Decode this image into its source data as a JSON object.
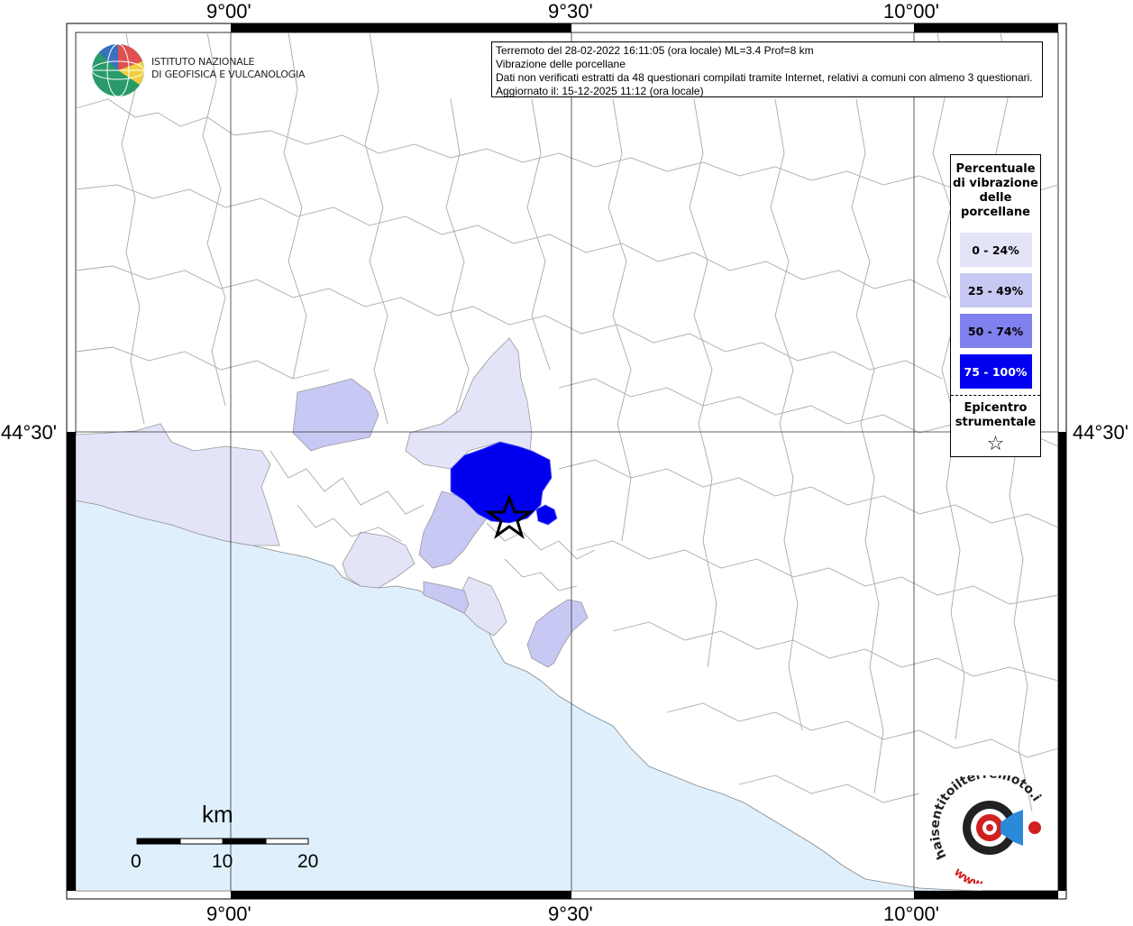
{
  "coords": {
    "top_labels": [
      "9°00'",
      "9°30'",
      "10°00'"
    ],
    "bottom_labels": [
      "9°00'",
      "9°30'",
      "10°00'"
    ],
    "left_label": "44°30'",
    "right_label": "44°30'"
  },
  "title_box": {
    "line1": "Terremoto del 28-02-2022 16:11:05 (ora locale) ML=3.4 Prof=8 km",
    "line2": "Vibrazione delle porcellane",
    "line3": "Dati non verificati estratti da 48 questionari compilati tramite Internet, relativi a comuni con almeno 3 questionari.",
    "line4": "Aggiornato il: 15-12-2025 11:12 (ora locale)"
  },
  "ingv": {
    "line1": "ISTITUTO NAZIONALE",
    "line2": "DI GEOFISICA E VULCANOLOGIA"
  },
  "legend": {
    "title_lines": [
      "Percentuale",
      "di vibrazione",
      "delle",
      "porcellane"
    ],
    "items": [
      {
        "label": "0 - 24%",
        "color": "#e4e4f8",
        "text_color": "#000000"
      },
      {
        "label": "25 - 49%",
        "color": "#c8c8f4",
        "text_color": "#000000"
      },
      {
        "label": "50 - 74%",
        "color": "#8080ee",
        "text_color": "#000000"
      },
      {
        "label": "75 - 100%",
        "color": "#0000ee",
        "text_color": "#ffffff"
      }
    ],
    "epicenter_lines": [
      "Epicentro",
      "strumentale"
    ],
    "star": "☆"
  },
  "scale_bar": {
    "unit": "km",
    "ticks": [
      "0",
      "10",
      "20"
    ]
  },
  "colors": {
    "sea": "#dff0fc",
    "land": "#ffffff",
    "border": "#999999",
    "grid": "#333333"
  },
  "hst_logo": {
    "text": "haisentitoilterremoto.it",
    "url": "www."
  }
}
